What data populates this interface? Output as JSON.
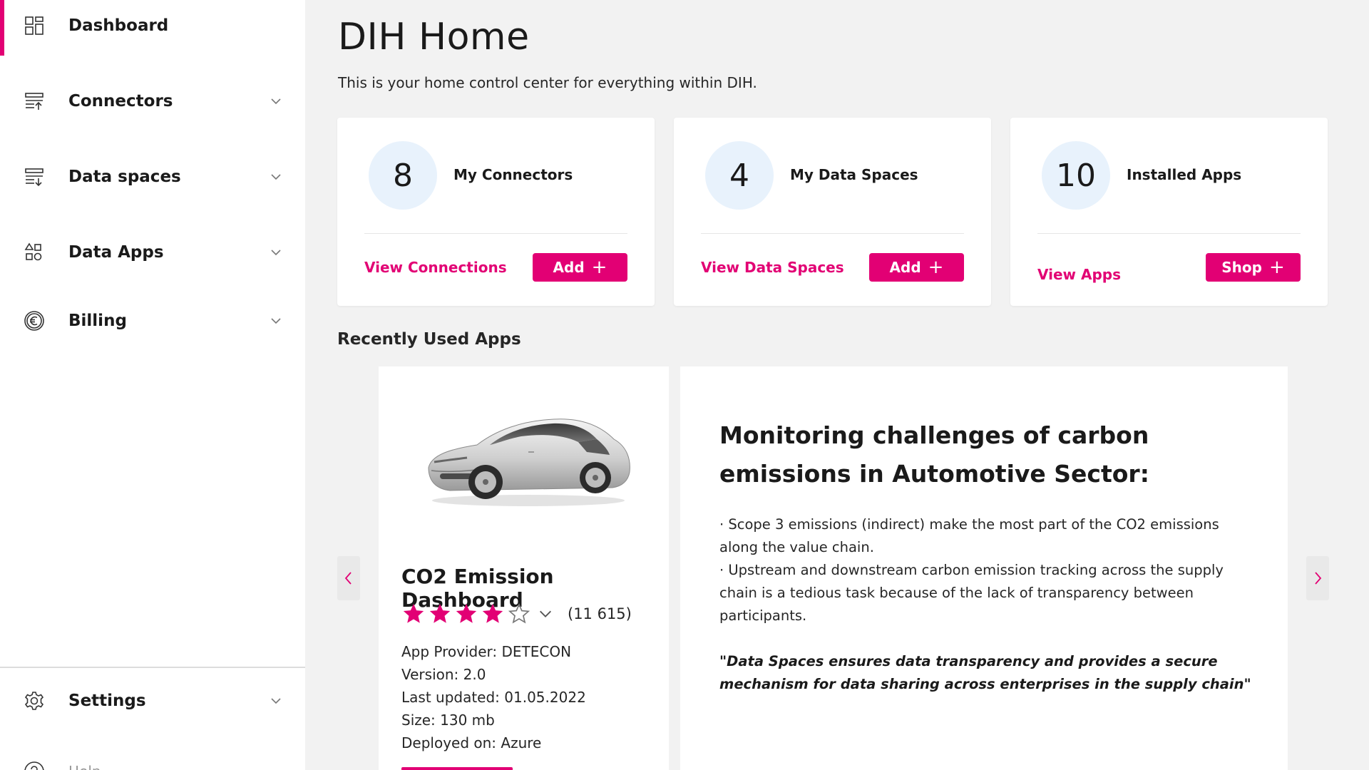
{
  "sidebar": {
    "items": [
      {
        "label": "Dashboard",
        "icon": "dashboard-icon"
      },
      {
        "label": "Connectors",
        "icon": "connectors-icon"
      },
      {
        "label": "Data spaces",
        "icon": "data-spaces-icon"
      },
      {
        "label": "Data Apps",
        "icon": "data-apps-icon"
      },
      {
        "label": "Billing",
        "icon": "euro-icon"
      }
    ],
    "settings_label": "Settings",
    "help_label": "Help"
  },
  "main": {
    "title": "DIH Home",
    "subtitle": "This is your home control center for everything within DIH.",
    "stats": [
      {
        "count": "8",
        "label": "My Connectors",
        "link": "View Connections",
        "button": "Add"
      },
      {
        "count": "4",
        "label": "My Data Spaces",
        "link": "View Data Spaces",
        "button": "Add"
      },
      {
        "count": "10",
        "label": "Installed Apps",
        "link": "View Apps",
        "button": "Shop"
      }
    ],
    "recent_title": "Recently Used Apps",
    "app": {
      "name": "CO2 Emission Dashboard",
      "rating": 4,
      "rating_max": 5,
      "rating_count": "(11 615)",
      "provider": "App Provider: DETECON",
      "version": "Version: 2.0",
      "updated": "Last updated: 01.05.2022",
      "size": "Size: 130 mb",
      "deployed": "Deployed on: Azure"
    },
    "description": {
      "title": "Monitoring challenges of carbon emissions in Automotive Sector:",
      "bullet1": "· Scope 3 emissions (indirect) make the most part of the CO2 emissions along the value chain.",
      "bullet2": "· Upstream and downstream carbon emission tracking across the supply chain is a tedious task because of the lack of transparency between participants.",
      "quote": "\"Data Spaces ensures data transparency and provides a secure mechanism for data sharing across enterprises in the supply chain\""
    }
  },
  "colors": {
    "accent": "#e20074",
    "circle_bg": "#e8f2fc",
    "page_bg": "#f2f2f2"
  }
}
